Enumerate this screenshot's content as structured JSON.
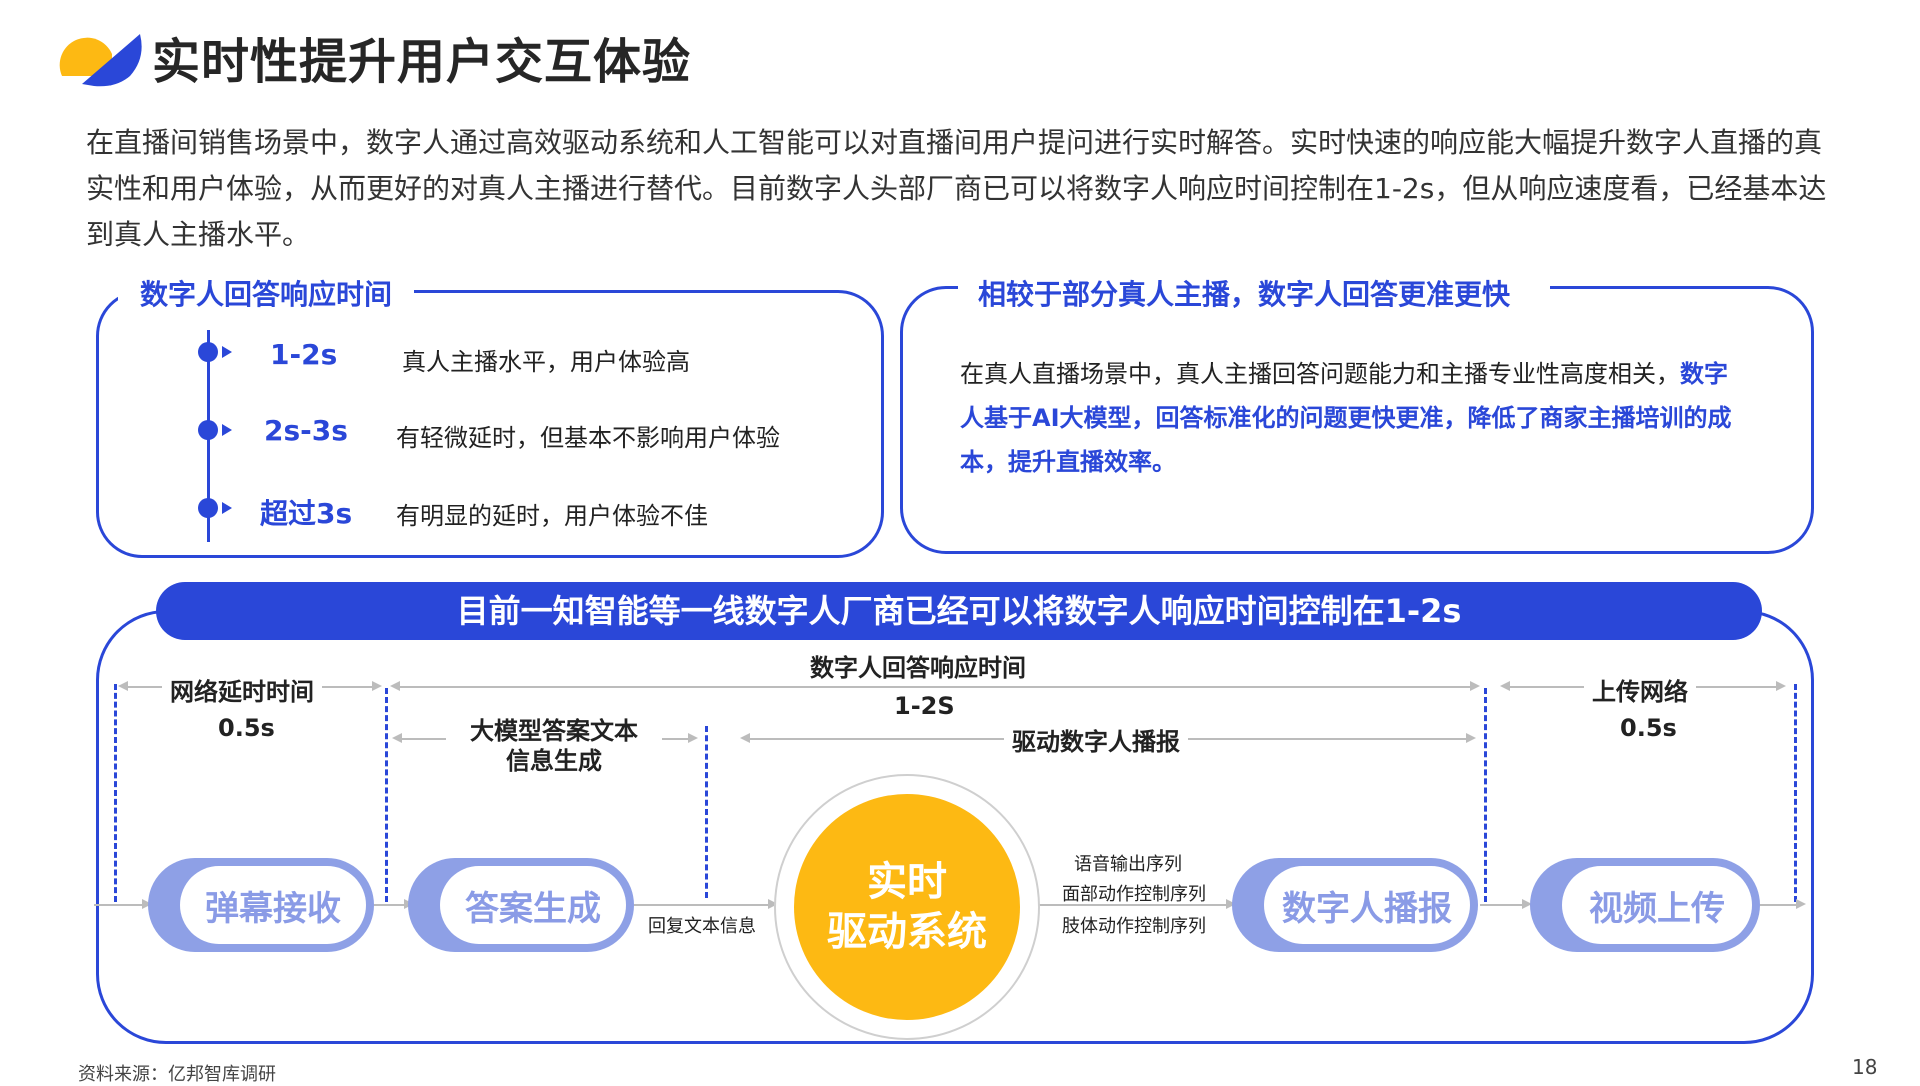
{
  "header": {
    "title": "实时性提升用户交互体验",
    "intro": "在直播间销售场景中，数字人通过高效驱动系统和人工智能可以对直播间用户提问进行实时解答。实时快速的响应能大幅提升数字人直播的真实性和用户体验，从而更好的对真人主播进行替代。目前数字人头部厂商已可以将数字人响应时间控制在1-2s，但从响应速度看，已经基本达到真人主播水平。"
  },
  "left_panel": {
    "title": "数字人回答响应时间",
    "items": [
      {
        "label": "1-2s",
        "desc": "真人主播水平，用户体验高"
      },
      {
        "label": "2s-3s",
        "desc": "有轻微延时，但基本不影响用户体验"
      },
      {
        "label": "超过3s",
        "desc": "有明显的延时，用户体验不佳"
      }
    ]
  },
  "right_panel": {
    "title": "相较于部分真人主播，数字人回答更准更快",
    "text_normal": "在真人直播场景中，真人主播回答问题能力和主播专业性高度相关，",
    "text_highlight": "数字人基于AI大模型，回答标准化的问题更快更准，降低了商家主播培训的成本，提升直播效率。"
  },
  "diagram": {
    "banner": "目前一知智能等一线数字人厂商已经可以将数字人响应时间控制在1-2s",
    "network_delay_label": "网络延时时间",
    "network_delay_value": "0.5s",
    "response_label": "数字人回答响应时间",
    "response_value": "1-2S",
    "llm_label": "大模型答案文本\n信息生成",
    "drive_label": "驱动数字人播报",
    "upload_label": "上传网络",
    "upload_value": "0.5s",
    "pills": [
      "弹幕接收",
      "答案生成",
      "数字人播报",
      "视频上传"
    ],
    "center": "实时\n驱动系统",
    "reply_text": "回复文本信息",
    "outputs": [
      "语音输出序列",
      "面部动作控制序列",
      "肢体动作控制序列"
    ]
  },
  "footer": {
    "source": "资料来源：亿邦智库调研",
    "page": "18"
  },
  "colors": {
    "accent": "#2a47d8",
    "yellow": "#fdb913",
    "pill": "#8ea0e6"
  }
}
